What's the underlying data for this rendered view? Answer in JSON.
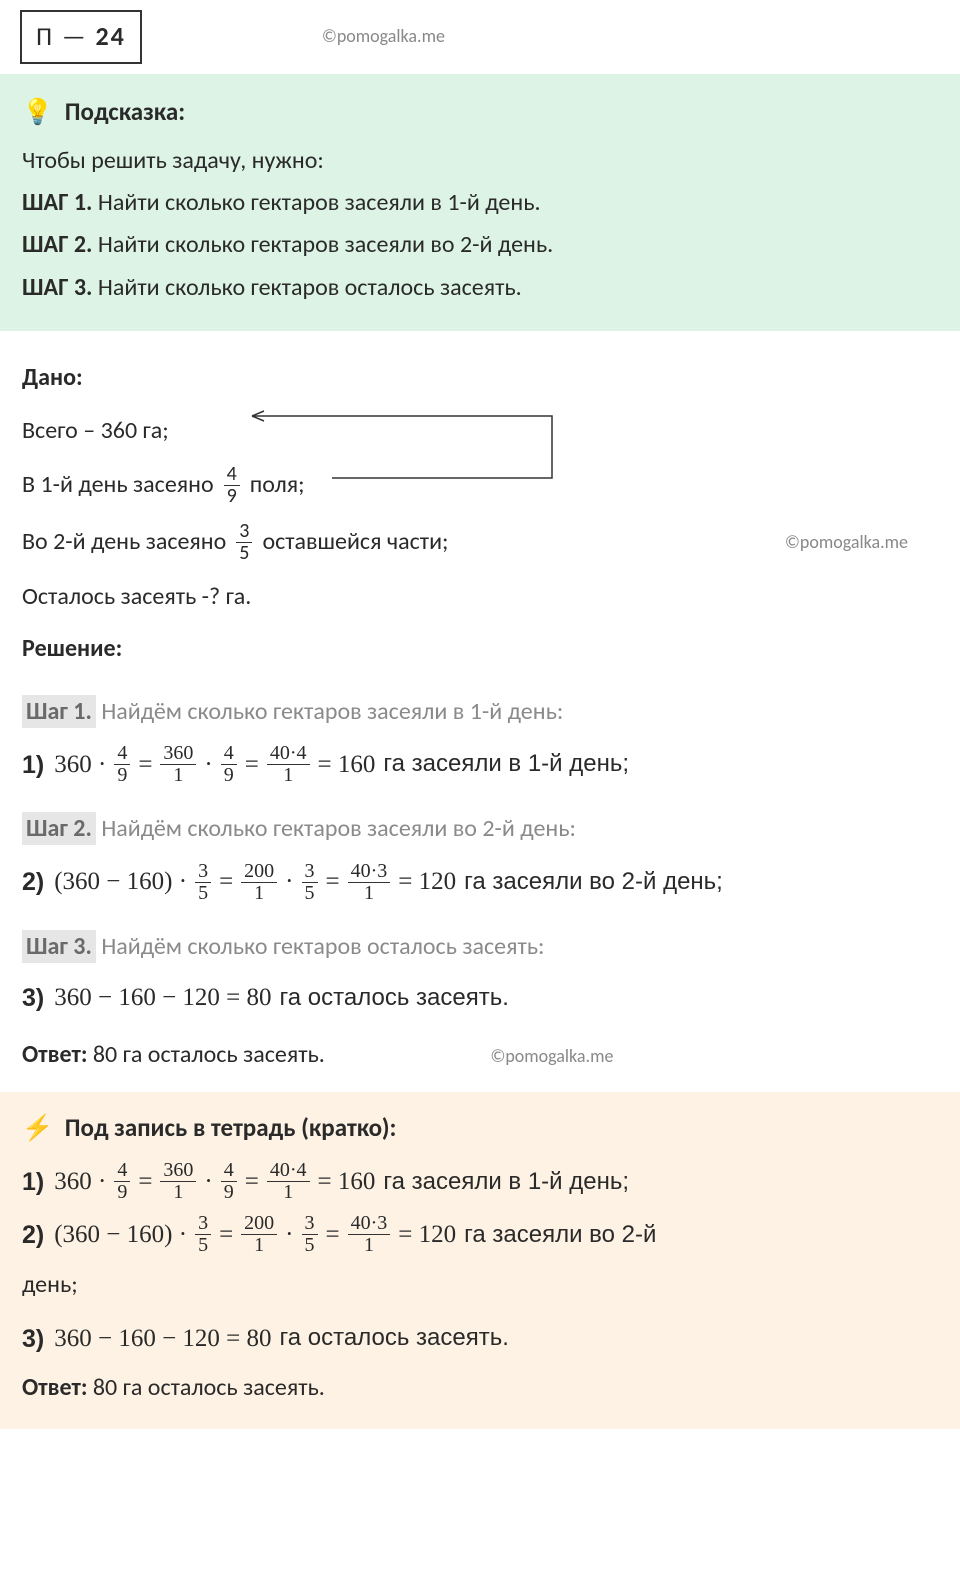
{
  "header": {
    "badge_prefix": "П —",
    "badge_number": "24",
    "watermark": "©pomogalka.me"
  },
  "hint": {
    "icon": "💡",
    "title": "Подсказка:",
    "intro": "Чтобы решить задачу, нужно:",
    "steps": [
      {
        "label": "ШАГ 1.",
        "text": "Найти сколько гектаров засеяли в 1-й день."
      },
      {
        "label": "ШАГ 2.",
        "text": "Найти сколько гектаров засеяли во 2-й день."
      },
      {
        "label": "ШАГ 3.",
        "text": "Найти сколько гектаров осталось засеять."
      }
    ]
  },
  "given": {
    "title": "Дано:",
    "total": "Всего – 360 га;",
    "day1_pre": "В 1-й день засеяно",
    "day1_frac_num": "4",
    "day1_frac_den": "9",
    "day1_post": "поля;",
    "day2_pre": "Во 2-й день засеяно",
    "day2_frac_num": "3",
    "day2_frac_den": "5",
    "day2_post": "оставшейся части;",
    "remain": "Осталось засеять -? га.",
    "watermark": "©pomogalka.me"
  },
  "solution": {
    "title": "Решение:",
    "steps": [
      {
        "hl": "Шаг 1.",
        "desc": "Найдём сколько гектаров засеяли в 1-й день:"
      },
      {
        "hl": "Шаг 2.",
        "desc": "Найдём сколько гектаров засеяли во 2-й день:"
      },
      {
        "hl": "Шаг 3.",
        "desc": "Найдём сколько гектаров осталось засеять:"
      }
    ],
    "eq1": {
      "lbl": "1)",
      "a": "360 ·",
      "f1n": "4",
      "f1d": "9",
      "eq1": "=",
      "f2n": "360",
      "f2d": "1",
      "mid": "·",
      "f3n": "4",
      "f3d": "9",
      "eq2": "=",
      "f4n": "40·4",
      "f4d": "1",
      "res": "= 160",
      "txt": "га засеяли в 1-й день;"
    },
    "eq2": {
      "lbl": "2)",
      "a": "(360 − 160) ·",
      "f1n": "3",
      "f1d": "5",
      "eq1": "=",
      "f2n": "200",
      "f2d": "1",
      "mid": "·",
      "f3n": "3",
      "f3d": "5",
      "eq2": "=",
      "f4n": "40·3",
      "f4d": "1",
      "res": "= 120",
      "txt": "га засеяли во 2-й день;"
    },
    "eq3": {
      "lbl": "3)",
      "expr": "360 − 160 − 120 = 80",
      "txt": "га осталось засеять."
    },
    "answer_label": "Ответ:",
    "answer_text": "80 га осталось засеять.",
    "watermark": "©pomogalka.me"
  },
  "notebook": {
    "icon": "⚡",
    "title": "Под запись в тетрадь (кратко):",
    "eq1": {
      "lbl": "1)",
      "a": "360 ·",
      "f1n": "4",
      "f1d": "9",
      "eq1": "=",
      "f2n": "360",
      "f2d": "1",
      "mid": "·",
      "f3n": "4",
      "f3d": "9",
      "eq2": "=",
      "f4n": "40·4",
      "f4d": "1",
      "res": "= 160",
      "txt": "га засеяли в 1-й день;"
    },
    "eq2": {
      "lbl": "2)",
      "a": "(360 − 160) ·",
      "f1n": "3",
      "f1d": "5",
      "eq1": "=",
      "f2n": "200",
      "f2d": "1",
      "mid": "·",
      "f3n": "3",
      "f3d": "5",
      "eq2": "=",
      "f4n": "40·3",
      "f4d": "1",
      "res": "= 120",
      "txt": "га засеяли во 2-й"
    },
    "eq2_wrap": "день;",
    "eq3": {
      "lbl": "3)",
      "expr": "360 − 160 − 120 = 80",
      "txt": "га осталось засеять."
    },
    "answer_label": "Ответ:",
    "answer_text": "80 га осталось засеять."
  }
}
